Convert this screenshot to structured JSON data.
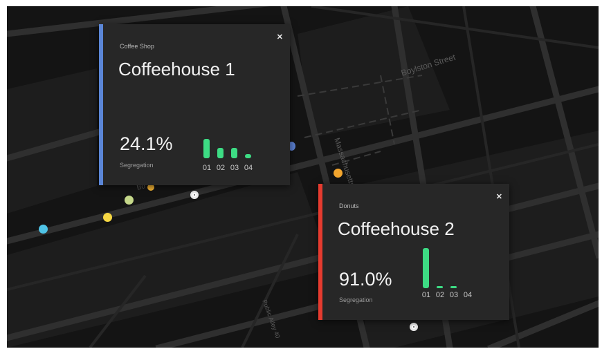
{
  "map": {
    "street_labels": [
      "Boylston Street",
      "Massachusetts",
      "Public Alley 40",
      "Bo"
    ],
    "markers": [
      {
        "color": "#4fc3e6"
      },
      {
        "color": "#f6d743"
      },
      {
        "color": "#c5d88a"
      },
      {
        "color": "#f3b334"
      },
      {
        "color": "#f3a62e"
      },
      {
        "color": "#5b7fd1"
      }
    ]
  },
  "cards": [
    {
      "accent_color": "#5b86d6",
      "category": "Coffee Shop",
      "close_icon": "close-icon",
      "name": "Coffeehouse 1",
      "metric_value": "24.1%",
      "metric_label": "Segregation",
      "chart": {
        "categories": [
          "01",
          "02",
          "03",
          "04"
        ],
        "values": [
          1.0,
          0.55,
          0.55,
          0.2
        ],
        "bar_color": "#3ddc84"
      }
    },
    {
      "accent_color": "#e53b2f",
      "category": "Donuts",
      "close_icon": "close-icon",
      "name": "Coffeehouse 2",
      "metric_value": "91.0%",
      "metric_label": "Segregation",
      "chart": {
        "categories": [
          "01",
          "02",
          "03",
          "04"
        ],
        "values": [
          1.0,
          0.05,
          0.05,
          0.0
        ],
        "bar_color": "#3ddc84"
      }
    }
  ]
}
